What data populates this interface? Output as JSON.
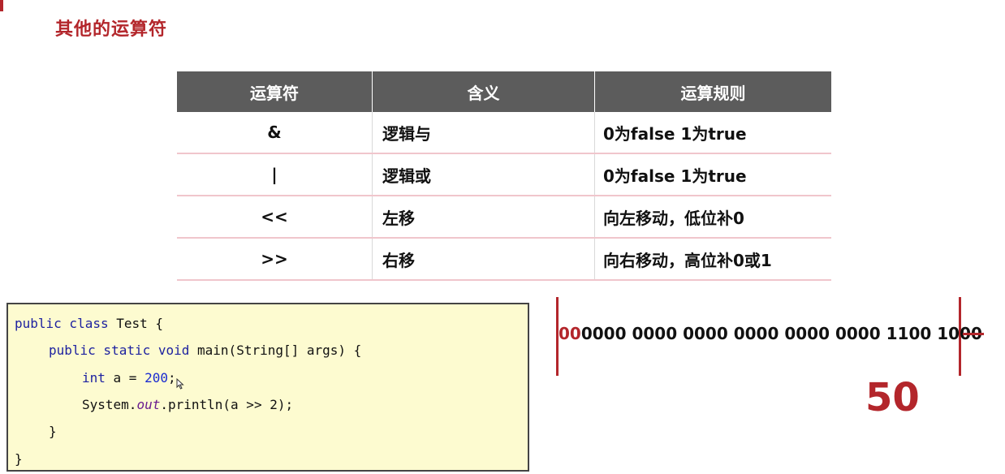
{
  "title": "其他的运算符",
  "table": {
    "headers": [
      "运算符",
      "含义",
      "运算规则"
    ],
    "rows": [
      {
        "op": "&",
        "meaning": "逻辑与",
        "rule": "0为false 1为true"
      },
      {
        "op": "|",
        "meaning": "逻辑或",
        "rule": "0为false 1为true"
      },
      {
        "op": "<<",
        "meaning": "左移",
        "rule": "向左移动，低位补0"
      },
      {
        "op": ">>",
        "meaning": "右移",
        "rule": "向右移动，高位补0或1"
      }
    ]
  },
  "code": {
    "l1_kw": "public class",
    "l1_rest": " Test {",
    "l2_kw": "public static void",
    "l2_rest": " main(String[] args) {",
    "l3_kw": "int",
    "l3_mid": " a = ",
    "l3_num": "200",
    "l3_end": ";",
    "l4_a": "System.",
    "l4_out": "out",
    "l4_b": ".println(a >> 2);",
    "l5": "}",
    "l6": "}"
  },
  "binary": {
    "highlight": "00",
    "rest": "0000 0000 0000 0000 0000 0000 1100 1000"
  },
  "result": "50",
  "colors": {
    "accent": "#b3262b",
    "header_bg": "#5c5c5c",
    "code_bg": "#fdfbd0"
  }
}
